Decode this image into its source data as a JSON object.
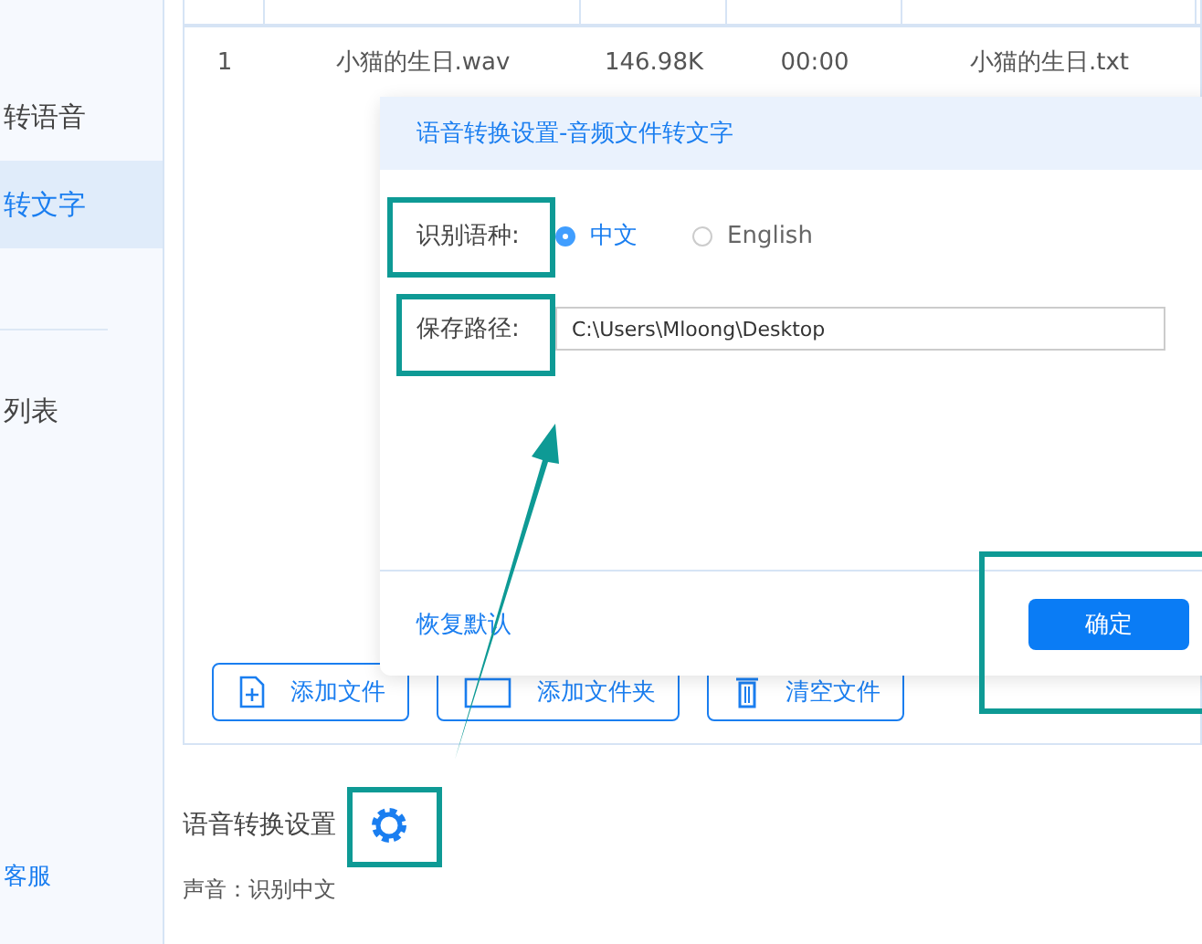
{
  "sidebar": {
    "items": [
      {
        "label": "转语音",
        "selected": false
      },
      {
        "label": "转文字",
        "selected": true
      },
      {
        "label": "列表",
        "selected": false
      }
    ],
    "footer_link": "客服"
  },
  "table": {
    "columns": [
      "",
      "",
      "",
      "",
      ""
    ],
    "rows": [
      [
        "1",
        "小猫的生日.wav",
        "146.98K",
        "00:00",
        "小猫的生日.txt"
      ]
    ]
  },
  "actions": [
    {
      "label": "添加文件",
      "kind": "file"
    },
    {
      "label": "添加文件夹",
      "kind": "folder"
    },
    {
      "label": "清空文件",
      "kind": "trash"
    }
  ],
  "settings": {
    "title": "语音转换设置",
    "sound": "声音：识别中文"
  },
  "dialog": {
    "title": "语音转换设置-音频文件转文字",
    "language_label": "识别语种:",
    "languages": [
      {
        "label": "中文",
        "selected": true
      },
      {
        "label": "English",
        "selected": false
      }
    ],
    "path_label": "保存路径:",
    "path": "C:\\Users\\Mloong\\Desktop",
    "reset": "恢复默认",
    "ok": "确定"
  }
}
